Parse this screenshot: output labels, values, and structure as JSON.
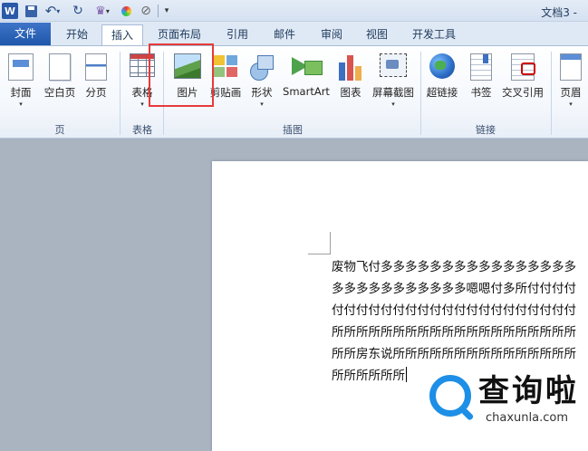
{
  "titlebar": {
    "app_logo": "W",
    "doc_title": "文档3 -",
    "icons": [
      "word-logo",
      "save-icon",
      "undo-icon",
      "redo-icon",
      "format-painter-icon",
      "color-icon",
      "clear-format-icon",
      "customize-icon"
    ]
  },
  "tabs": [
    {
      "label": "文件",
      "key": "file"
    },
    {
      "label": "开始",
      "key": "home"
    },
    {
      "label": "插入",
      "key": "insert",
      "active": true
    },
    {
      "label": "页面布局",
      "key": "layout"
    },
    {
      "label": "引用",
      "key": "references"
    },
    {
      "label": "邮件",
      "key": "mailings"
    },
    {
      "label": "审阅",
      "key": "review"
    },
    {
      "label": "视图",
      "key": "view"
    },
    {
      "label": "开发工具",
      "key": "developer"
    }
  ],
  "ribbon": {
    "groups": {
      "pages": {
        "label": "页",
        "cover": "封面",
        "blank": "空白页",
        "break": "分页"
      },
      "tables": {
        "label": "表格",
        "table": "表格"
      },
      "illustrations": {
        "label": "插图",
        "picture": "图片",
        "clipart": "剪贴画",
        "shapes": "形状",
        "smartart": "SmartArt",
        "chart": "图表",
        "screenshot": "屏幕截图"
      },
      "links": {
        "label": "链接",
        "hyperlink": "超链接",
        "bookmark": "书签",
        "crossref": "交叉引用"
      },
      "header": {
        "header": "页眉"
      }
    },
    "dropdown_arrow": "▾",
    "highlight_color": "#e83a3a"
  },
  "document": {
    "lines": [
      "废物飞付多多多多多多多多多多多多多多多多",
      "多多多多多多多多多多多嗯嗯付多所付付付付",
      "付付付付付付付付付付付付付付付付付付付付",
      "所所所所所所所所所所所所所所所所所所所所",
      "所所房东说所所所所所所所所所所所所所所所",
      "所所所所所所"
    ]
  },
  "watermark": {
    "cn": "查询啦",
    "en": "chaxunla.com"
  },
  "colors": {
    "file_tab": "#2b64b8",
    "accent": "#1d8fe6",
    "doc_bg": "#aab4c1"
  }
}
